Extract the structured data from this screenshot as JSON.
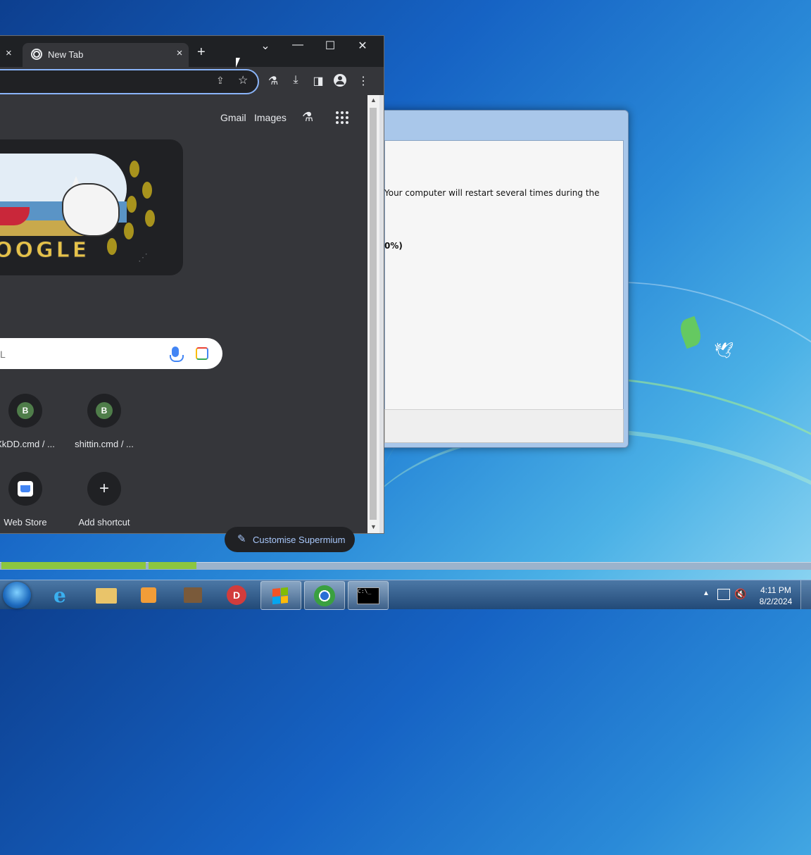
{
  "browser": {
    "tab_title": "New Tab",
    "tab_close": "×",
    "prev_tab_close": "×",
    "new_tab": "+",
    "window_controls": {
      "dropdown": "⌄",
      "minimize": "—",
      "maximize": "☐",
      "close": "✕"
    },
    "toolbar_icons": [
      "share-icon",
      "star-icon",
      "labs-icon",
      "download-icon",
      "side-panel-icon",
      "profile-icon",
      "menu-icon"
    ]
  },
  "ntp": {
    "gmail_label": "Gmail",
    "images_label": "Images",
    "doodle_text": "OOGLE",
    "search_placeholder": "L",
    "shortcuts": [
      {
        "label": "XkDD.cmd / ...",
        "badge": "B"
      },
      {
        "label": "shittin.cmd / ...",
        "badge": "B"
      },
      {
        "label": "Web Store",
        "badge": ""
      },
      {
        "label": "Add shortcut",
        "badge": "+"
      }
    ],
    "customise_label": "Customise Supermium"
  },
  "dialog": {
    "message": "Your computer will restart several times during the",
    "percent": "0%)"
  },
  "taskbar": {
    "time": "4:11 PM",
    "date": "8/2/2024",
    "apps": [
      "start-orb",
      "internet-explorer-icon",
      "file-explorer-icon",
      "media-player-icon",
      "archive-icon",
      "app-d-icon",
      "windows-setup-icon",
      "browser-icon",
      "cmd-icon"
    ]
  },
  "colors": {
    "accent": "#8ab4f8",
    "progress_green": "#8cc63f"
  }
}
